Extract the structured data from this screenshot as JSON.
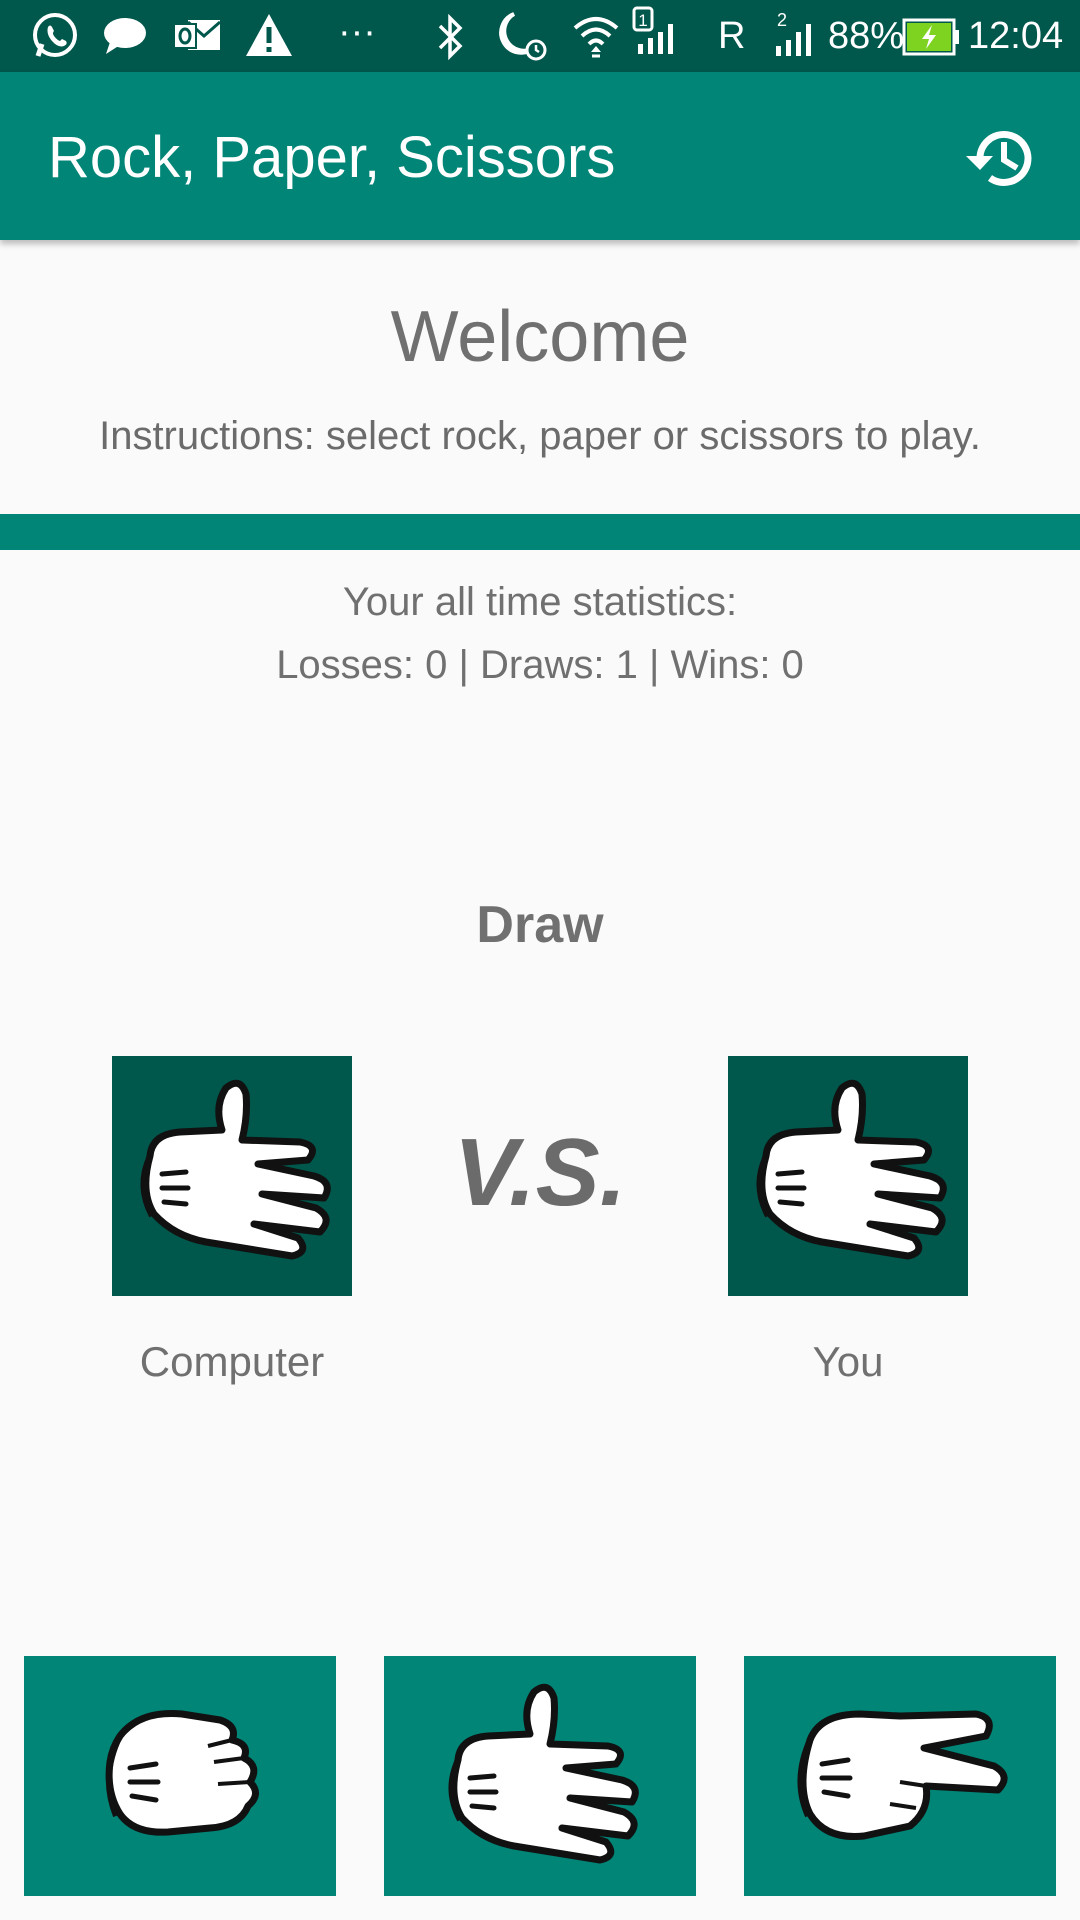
{
  "status_bar": {
    "icons": [
      "whatsapp-icon",
      "message-icon",
      "outlook-icon",
      "warning-icon",
      "more-icon",
      "bluetooth-icon",
      "moon-alarm-icon",
      "wifi-icon",
      "sim1-signal-icon",
      "sim2-signal-icon",
      "battery-charging-icon"
    ],
    "more_label": "···",
    "roaming_label": "R",
    "battery_percent": "88%",
    "time": "12:04"
  },
  "app_bar": {
    "title": "Rock, Paper, Scissors",
    "history_icon": "history-icon"
  },
  "welcome": {
    "title": "Welcome",
    "instructions": "Instructions: select rock, paper or scissors to play."
  },
  "stats": {
    "heading": "Your all time statistics:",
    "line": "Losses: 0 | Draws: 1 | Wins: 0"
  },
  "game": {
    "result": "Draw",
    "vs_label": "V.S.",
    "computer_label": "Computer",
    "you_label": "You",
    "computer_choice": "paper",
    "you_choice": "paper"
  },
  "choices": [
    {
      "name": "rock",
      "icon": "rock-hand-icon"
    },
    {
      "name": "paper",
      "icon": "paper-hand-icon"
    },
    {
      "name": "scissors",
      "icon": "scissors-hand-icon"
    }
  ],
  "colors": {
    "primary": "#008577",
    "primary_dark": "#00574b",
    "background": "#fafafa",
    "text_gray": "#707070"
  }
}
